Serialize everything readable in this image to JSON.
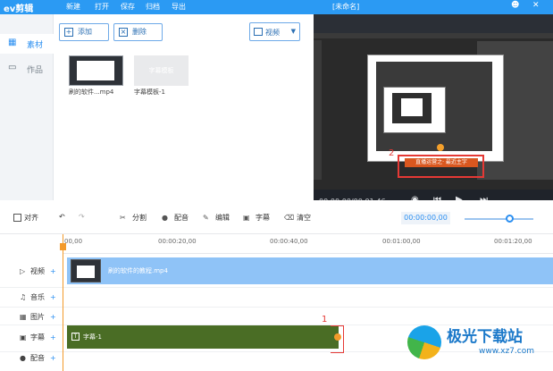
{
  "app": {
    "logo_text": "ev剪辑",
    "menu": [
      "新建",
      "打开",
      "保存",
      "归档",
      "导出"
    ],
    "doc_title": "[未命名]",
    "window_buttons": [
      "user-icon",
      "minimize-icon",
      "close-icon"
    ]
  },
  "nav": {
    "material": "素材",
    "works": "作品"
  },
  "library": {
    "add_label": "添加",
    "delete_label": "删除",
    "filter_value": "视频",
    "items": [
      {
        "caption": "刷的软件...mp4",
        "thumb_text": ""
      },
      {
        "caption": "字幕模板-1",
        "thumb_text": "字幕模板"
      }
    ]
  },
  "preview": {
    "time": "00:00:00/00:01:46",
    "caption_text": "直播运营之· 最近主字",
    "annotation_arrow": "2"
  },
  "toolbar": {
    "snap_label": "对齐",
    "split": "分割",
    "voice": "配音",
    "edit": "编辑",
    "subtitle": "字幕",
    "clear": "清空",
    "timecode": "00:00:00,00"
  },
  "timeline": {
    "ticks": [
      "00,00",
      "00:00:20,00",
      "00:00:40,00",
      "00:01:00,00",
      "00:01:20,00"
    ],
    "tracks": [
      {
        "label": "视频"
      },
      {
        "label": "音乐"
      },
      {
        "label": "图片"
      },
      {
        "label": "字幕"
      },
      {
        "label": "配音"
      }
    ],
    "video_clip_name": "刷的软件的教程.mp4",
    "subtitle_clip_name": "字幕-1",
    "annotation_number": "1"
  },
  "watermark": {
    "text": "极光下载站",
    "url": "www.xz7.com"
  },
  "colors": {
    "accent": "#2b9af3",
    "subtitle_clip": "#4a6d25",
    "video_clip": "#8fc3f7",
    "playhead": "#f39a2b",
    "annotation": "#e53935"
  }
}
